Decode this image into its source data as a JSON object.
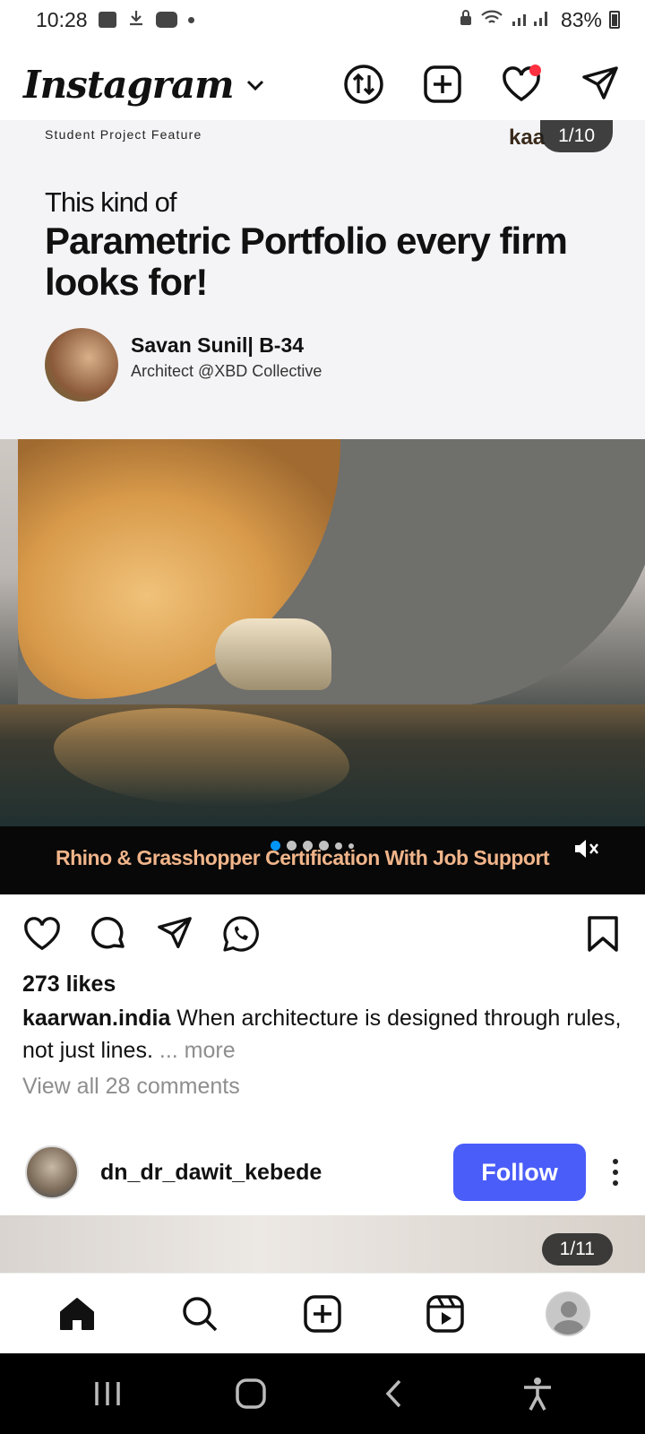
{
  "status_bar": {
    "time": "10:28",
    "battery": "83%"
  },
  "header": {
    "logo": "Instagram",
    "icons": [
      "threads-switch-icon",
      "new-post-icon",
      "activity-heart-icon",
      "direct-message-icon"
    ]
  },
  "post": {
    "slide_counter": "1/10",
    "overlay": {
      "feature_label": "Student Project Feature",
      "brand_mark": "kaa",
      "headline_small": "This kind of",
      "headline_big": "Parametric Portfolio every firm looks for!",
      "author_name": "Savan Sunil| B-34",
      "author_role": "Architect @XBD Collective"
    },
    "banner_text": "Rhino & Grasshopper Certification With Job Support",
    "carousel_dots": {
      "active_index": 0,
      "visible": 6
    },
    "likes": "273 likes",
    "caption_user": "kaarwan.india",
    "caption_text": " When architecture is designed through rules, not just lines.",
    "caption_more": " ... more",
    "view_comments": "View all 28 comments"
  },
  "next_post": {
    "username": "dn_dr_dawit_kebede",
    "follow_label": "Follow",
    "slide_counter": "1/11"
  },
  "colors": {
    "follow": "#4a5df9",
    "banner_text": "#f1b58a",
    "active_dot": "#0095f6",
    "notification": "#ff3040"
  }
}
